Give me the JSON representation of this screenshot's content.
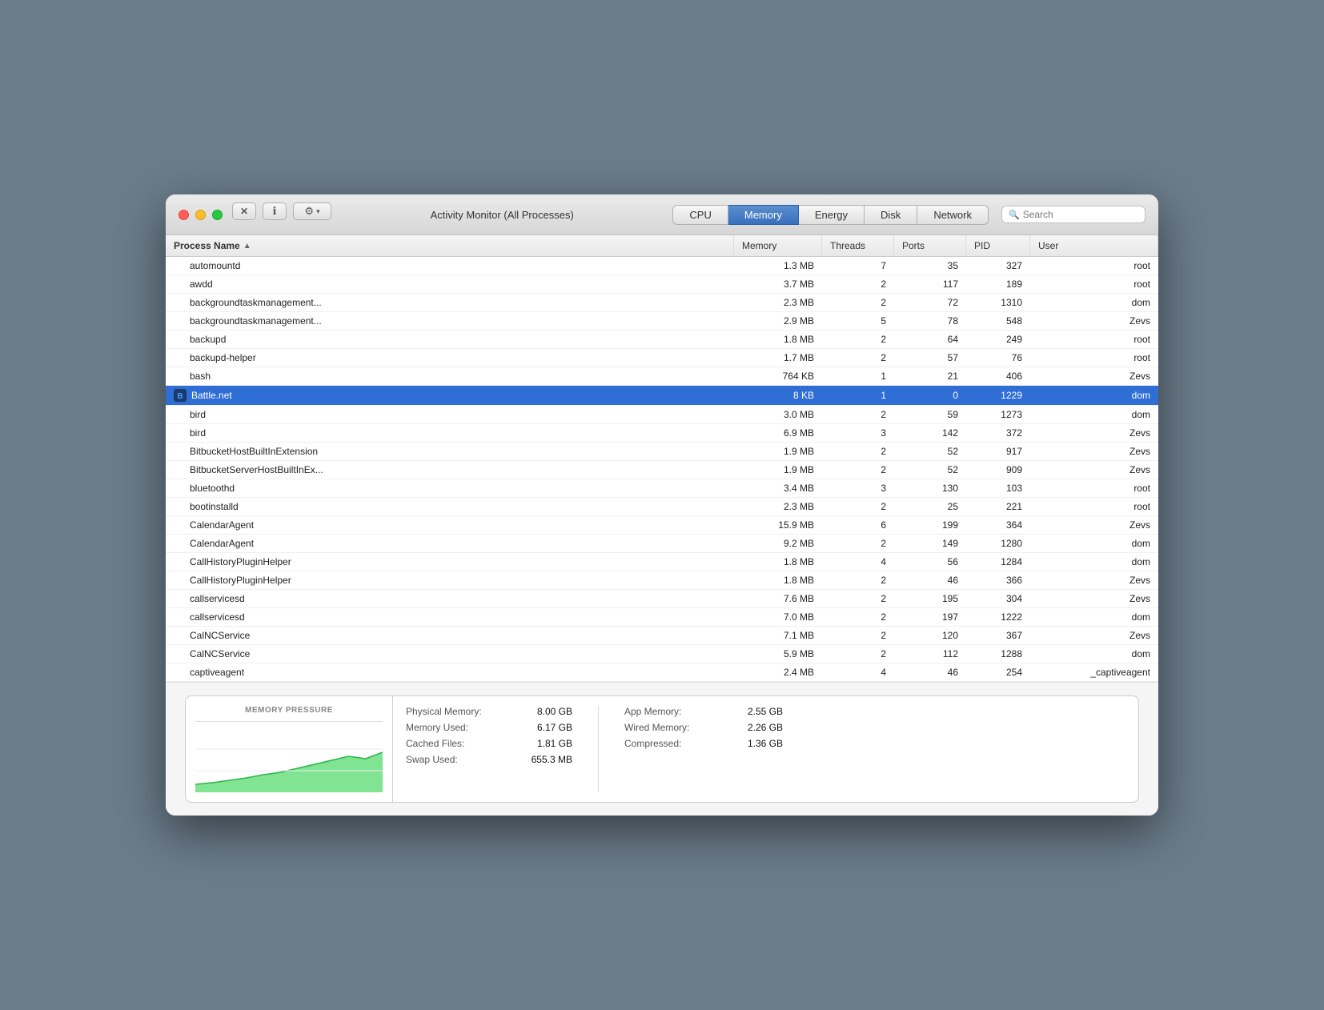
{
  "window": {
    "title": "Activity Monitor (All Processes)"
  },
  "toolbar": {
    "close_btn": "✕",
    "info_btn": "ⓘ",
    "gear_btn": "⚙",
    "dropdown_arrow": "▾",
    "search_placeholder": "Search"
  },
  "tabs": [
    {
      "id": "cpu",
      "label": "CPU",
      "active": false
    },
    {
      "id": "memory",
      "label": "Memory",
      "active": true
    },
    {
      "id": "energy",
      "label": "Energy",
      "active": false
    },
    {
      "id": "disk",
      "label": "Disk",
      "active": false
    },
    {
      "id": "network",
      "label": "Network",
      "active": false
    }
  ],
  "columns": [
    {
      "id": "process_name",
      "label": "Process Name"
    },
    {
      "id": "memory",
      "label": "Memory"
    },
    {
      "id": "threads",
      "label": "Threads"
    },
    {
      "id": "ports",
      "label": "Ports"
    },
    {
      "id": "pid",
      "label": "PID"
    },
    {
      "id": "user",
      "label": "User"
    }
  ],
  "rows": [
    {
      "name": "automountd",
      "memory": "1.3 MB",
      "threads": "7",
      "ports": "35",
      "pid": "327",
      "user": "root",
      "selected": false,
      "has_icon": false
    },
    {
      "name": "awdd",
      "memory": "3.7 MB",
      "threads": "2",
      "ports": "117",
      "pid": "189",
      "user": "root",
      "selected": false,
      "has_icon": false
    },
    {
      "name": "backgroundtaskmanagement...",
      "memory": "2.3 MB",
      "threads": "2",
      "ports": "72",
      "pid": "1310",
      "user": "dom",
      "selected": false,
      "has_icon": false
    },
    {
      "name": "backgroundtaskmanagement...",
      "memory": "2.9 MB",
      "threads": "5",
      "ports": "78",
      "pid": "548",
      "user": "Zevs",
      "selected": false,
      "has_icon": false
    },
    {
      "name": "backupd",
      "memory": "1.8 MB",
      "threads": "2",
      "ports": "64",
      "pid": "249",
      "user": "root",
      "selected": false,
      "has_icon": false
    },
    {
      "name": "backupd-helper",
      "memory": "1.7 MB",
      "threads": "2",
      "ports": "57",
      "pid": "76",
      "user": "root",
      "selected": false,
      "has_icon": false
    },
    {
      "name": "bash",
      "memory": "764 KB",
      "threads": "1",
      "ports": "21",
      "pid": "406",
      "user": "Zevs",
      "selected": false,
      "has_icon": false
    },
    {
      "name": "Battle.net",
      "memory": "8 KB",
      "threads": "1",
      "ports": "0",
      "pid": "1229",
      "user": "dom",
      "selected": true,
      "has_icon": true
    },
    {
      "name": "bird",
      "memory": "3.0 MB",
      "threads": "2",
      "ports": "59",
      "pid": "1273",
      "user": "dom",
      "selected": false,
      "has_icon": false
    },
    {
      "name": "bird",
      "memory": "6.9 MB",
      "threads": "3",
      "ports": "142",
      "pid": "372",
      "user": "Zevs",
      "selected": false,
      "has_icon": false
    },
    {
      "name": "BitbucketHostBuiltInExtension",
      "memory": "1.9 MB",
      "threads": "2",
      "ports": "52",
      "pid": "917",
      "user": "Zevs",
      "selected": false,
      "has_icon": false
    },
    {
      "name": "BitbucketServerHostBuiltInEx...",
      "memory": "1.9 MB",
      "threads": "2",
      "ports": "52",
      "pid": "909",
      "user": "Zevs",
      "selected": false,
      "has_icon": false
    },
    {
      "name": "bluetoothd",
      "memory": "3.4 MB",
      "threads": "3",
      "ports": "130",
      "pid": "103",
      "user": "root",
      "selected": false,
      "has_icon": false
    },
    {
      "name": "bootinstalld",
      "memory": "2.3 MB",
      "threads": "2",
      "ports": "25",
      "pid": "221",
      "user": "root",
      "selected": false,
      "has_icon": false
    },
    {
      "name": "CalendarAgent",
      "memory": "15.9 MB",
      "threads": "6",
      "ports": "199",
      "pid": "364",
      "user": "Zevs",
      "selected": false,
      "has_icon": false
    },
    {
      "name": "CalendarAgent",
      "memory": "9.2 MB",
      "threads": "2",
      "ports": "149",
      "pid": "1280",
      "user": "dom",
      "selected": false,
      "has_icon": false
    },
    {
      "name": "CallHistoryPluginHelper",
      "memory": "1.8 MB",
      "threads": "4",
      "ports": "56",
      "pid": "1284",
      "user": "dom",
      "selected": false,
      "has_icon": false
    },
    {
      "name": "CallHistoryPluginHelper",
      "memory": "1.8 MB",
      "threads": "2",
      "ports": "46",
      "pid": "366",
      "user": "Zevs",
      "selected": false,
      "has_icon": false
    },
    {
      "name": "callservicesd",
      "memory": "7.6 MB",
      "threads": "2",
      "ports": "195",
      "pid": "304",
      "user": "Zevs",
      "selected": false,
      "has_icon": false
    },
    {
      "name": "callservicesd",
      "memory": "7.0 MB",
      "threads": "2",
      "ports": "197",
      "pid": "1222",
      "user": "dom",
      "selected": false,
      "has_icon": false
    },
    {
      "name": "CalNCService",
      "memory": "7.1 MB",
      "threads": "2",
      "ports": "120",
      "pid": "367",
      "user": "Zevs",
      "selected": false,
      "has_icon": false
    },
    {
      "name": "CalNCService",
      "memory": "5.9 MB",
      "threads": "2",
      "ports": "112",
      "pid": "1288",
      "user": "dom",
      "selected": false,
      "has_icon": false
    },
    {
      "name": "captiveagent",
      "memory": "2.4 MB",
      "threads": "4",
      "ports": "46",
      "pid": "254",
      "user": "_captiveagent",
      "selected": false,
      "has_icon": false
    }
  ],
  "bottom_panel": {
    "memory_pressure_label": "MEMORY PRESSURE",
    "stats_left": [
      {
        "label": "Physical Memory:",
        "value": "8.00 GB"
      },
      {
        "label": "Memory Used:",
        "value": "6.17 GB"
      },
      {
        "label": "Cached Files:",
        "value": "1.81 GB"
      },
      {
        "label": "Swap Used:",
        "value": "655.3 MB"
      }
    ],
    "stats_right": [
      {
        "label": "App Memory:",
        "value": "2.55 GB"
      },
      {
        "label": "Wired Memory:",
        "value": "2.26 GB"
      },
      {
        "label": "Compressed:",
        "value": "1.36 GB"
      }
    ]
  }
}
